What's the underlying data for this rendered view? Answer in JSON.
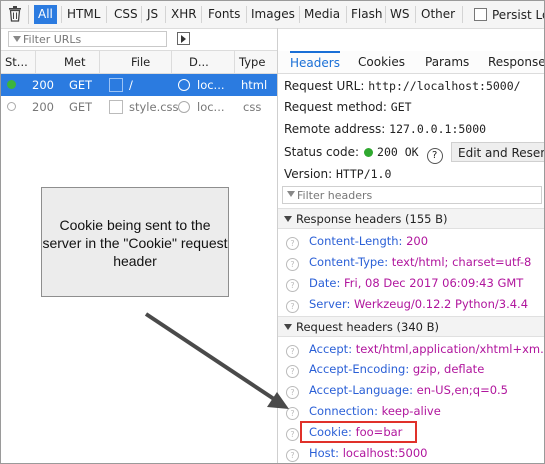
{
  "toolbar": {
    "filters": [
      "All",
      "HTML",
      "CSS",
      "JS",
      "XHR",
      "Fonts",
      "Images",
      "Media",
      "Flash",
      "WS",
      "Other"
    ],
    "persist_label": "Persist Logs",
    "filter_urls_placeholder": "Filter URLs"
  },
  "table": {
    "headers": [
      "St...",
      "Met",
      "File",
      "D...",
      "Type"
    ],
    "rows": [
      {
        "status": "200",
        "method": "GET",
        "file": "/",
        "domain": "loc...",
        "type": "html"
      },
      {
        "status": "200",
        "method": "GET",
        "file": "style.css",
        "domain": "loc...",
        "type": "css"
      }
    ]
  },
  "details": {
    "tabs": [
      "Headers",
      "Cookies",
      "Params",
      "Response"
    ],
    "request_url_label": "Request URL:",
    "request_url": "http://localhost:5000/",
    "request_method_label": "Request method:",
    "request_method": "GET",
    "remote_address_label": "Remote address:",
    "remote_address": "127.0.0.1:5000",
    "status_code_label": "Status code:",
    "status_code": "200 OK",
    "edit_resend_label": "Edit and Resend",
    "version_label": "Version:",
    "version": "HTTP/1.0",
    "filter_headers_placeholder": "Filter headers",
    "response_headers_title": "Response headers (155 B)",
    "response_headers": [
      {
        "name": "Content-Length:",
        "value": "200"
      },
      {
        "name": "Content-Type:",
        "value": "text/html; charset=utf-8"
      },
      {
        "name": "Date:",
        "value": "Fri, 08 Dec 2017 06:09:43 GMT"
      },
      {
        "name": "Server:",
        "value": "Werkzeug/0.12.2 Python/3.4.4"
      }
    ],
    "request_headers_title": "Request headers (340 B)",
    "request_headers": [
      {
        "name": "Accept:",
        "value": "text/html,application/xhtml+xm...pl"
      },
      {
        "name": "Accept-Encoding:",
        "value": "gzip, deflate"
      },
      {
        "name": "Accept-Language:",
        "value": "en-US,en;q=0.5"
      },
      {
        "name": "Connection:",
        "value": "keep-alive"
      },
      {
        "name": "Cookie:",
        "value": "foo=bar"
      },
      {
        "name": "Host:",
        "value": "localhost:5000"
      }
    ]
  },
  "annotation": {
    "text": "Cookie being sent to the server in the \"Cookie\" request header"
  },
  "colors": {
    "accent": "#2b7be0",
    "header_name": "#2a5fd6",
    "header_value": "#b0159d",
    "highlight_box": "#e0312a",
    "status_ok": "#2fa82f"
  }
}
